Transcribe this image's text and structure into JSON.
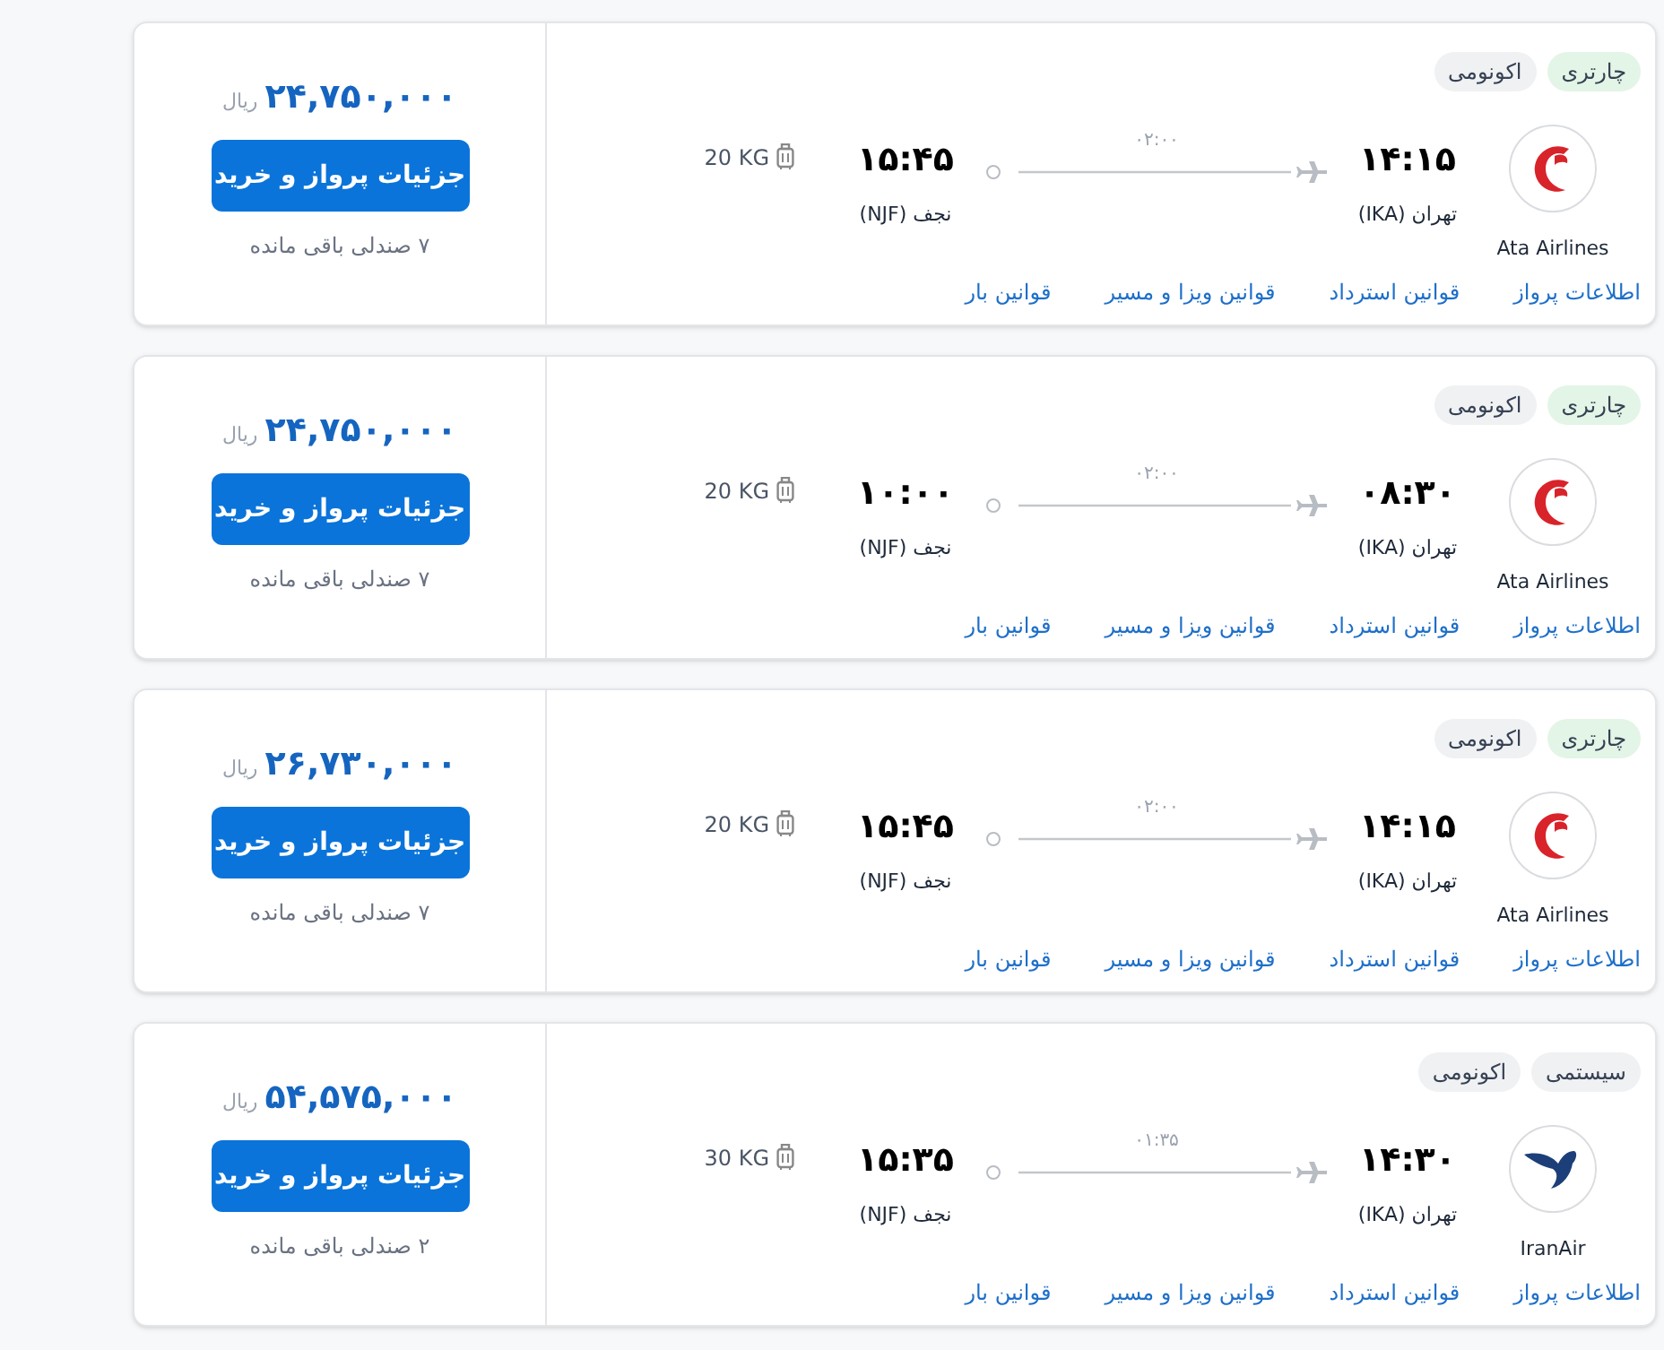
{
  "flights": [
    {
      "tags": [
        {
          "label": "چارتری",
          "color": "#e3f5e6"
        },
        {
          "label": "اکونومی",
          "color": "#f0f1f3"
        }
      ],
      "airline": {
        "name": "Ata Airlines",
        "kind": "ata"
      },
      "departure": {
        "time": "۱۴:۱۵",
        "city": "تهران (IKA)"
      },
      "duration": "۰۲:۰۰",
      "arrival": {
        "time": "۱۵:۴۵",
        "city": "نجف (NJF)"
      },
      "baggage": "20 KG",
      "links": [
        "اطلاعات پرواز",
        "قوانین استرداد",
        "قوانین ویزا و مسیر",
        "قوانین بار"
      ],
      "price": "۲۴,۷۵۰,۰۰۰",
      "currency": "ریال",
      "button": "جزئیات پرواز و خرید",
      "seats": "۷ صندلی باقی مانده"
    },
    {
      "tags": [
        {
          "label": "چارتری",
          "color": "#e3f5e6"
        },
        {
          "label": "اکونومی",
          "color": "#f0f1f3"
        }
      ],
      "airline": {
        "name": "Ata Airlines",
        "kind": "ata"
      },
      "departure": {
        "time": "۰۸:۳۰",
        "city": "تهران (IKA)"
      },
      "duration": "۰۲:۰۰",
      "arrival": {
        "time": "۱۰:۰۰",
        "city": "نجف (NJF)"
      },
      "baggage": "20 KG",
      "links": [
        "اطلاعات پرواز",
        "قوانین استرداد",
        "قوانین ویزا و مسیر",
        "قوانین بار"
      ],
      "price": "۲۴,۷۵۰,۰۰۰",
      "currency": "ریال",
      "button": "جزئیات پرواز و خرید",
      "seats": "۷ صندلی باقی مانده"
    },
    {
      "tags": [
        {
          "label": "چارتری",
          "color": "#e3f5e6"
        },
        {
          "label": "اکونومی",
          "color": "#f0f1f3"
        }
      ],
      "airline": {
        "name": "Ata Airlines",
        "kind": "ata"
      },
      "departure": {
        "time": "۱۴:۱۵",
        "city": "تهران (IKA)"
      },
      "duration": "۰۲:۰۰",
      "arrival": {
        "time": "۱۵:۴۵",
        "city": "نجف (NJF)"
      },
      "baggage": "20 KG",
      "links": [
        "اطلاعات پرواز",
        "قوانین استرداد",
        "قوانین ویزا و مسیر",
        "قوانین بار"
      ],
      "price": "۲۶,۷۳۰,۰۰۰",
      "currency": "ریال",
      "button": "جزئیات پرواز و خرید",
      "seats": "۷ صندلی باقی مانده"
    },
    {
      "tags": [
        {
          "label": "سیستمی",
          "color": "#f0f1f3"
        },
        {
          "label": "اکونومی",
          "color": "#f0f1f3"
        }
      ],
      "airline": {
        "name": "IranAir",
        "kind": "iranair"
      },
      "departure": {
        "time": "۱۴:۳۰",
        "city": "تهران (IKA)"
      },
      "duration": "۰۱:۳۵",
      "arrival": {
        "time": "۱۵:۳۵",
        "city": "نجف (NJF)"
      },
      "baggage": "30 KG",
      "links": [
        "اطلاعات پرواز",
        "قوانین استرداد",
        "قوانین ویزا و مسیر",
        "قوانین بار"
      ],
      "price": "۵۴,۵۷۵,۰۰۰",
      "currency": "ریال",
      "button": "جزئیات پرواز و خرید",
      "seats": "۲ صندلی باقی مانده"
    }
  ]
}
